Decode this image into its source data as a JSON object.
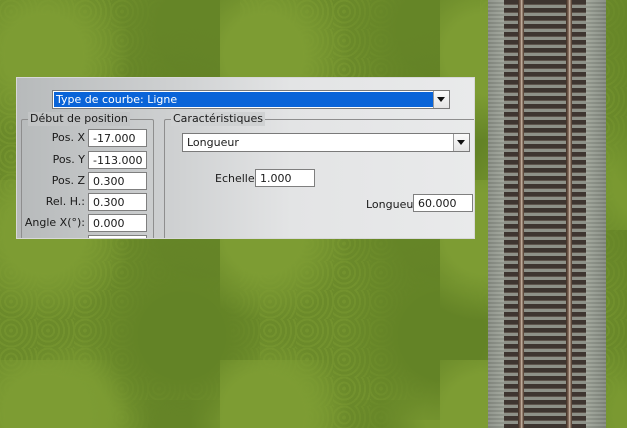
{
  "scene": {
    "grass_color": "#6f8f2c",
    "ballast_color": "#9da294",
    "rail_color": "#8a7060"
  },
  "curve_type": {
    "selected": "Type de courbe: Ligne"
  },
  "start_position": {
    "title": "Début de position",
    "fields": [
      {
        "label": "Pos. X",
        "value": "-17.000"
      },
      {
        "label": "Pos. Y",
        "value": "-113.000"
      },
      {
        "label": "Pos. Z",
        "value": "0.300"
      },
      {
        "label": "Rel. H.:",
        "value": "0.300"
      },
      {
        "label": "Angle X(°):",
        "value": "0.000"
      }
    ]
  },
  "characteristics": {
    "title": "Caractéristiques",
    "mode_selected": "Longueur",
    "scale_label": "Echelle:",
    "scale_value": "1.000",
    "length_label": "Longueur",
    "length_value": "60.000"
  },
  "colors": {
    "selection": "#0a64d8"
  }
}
